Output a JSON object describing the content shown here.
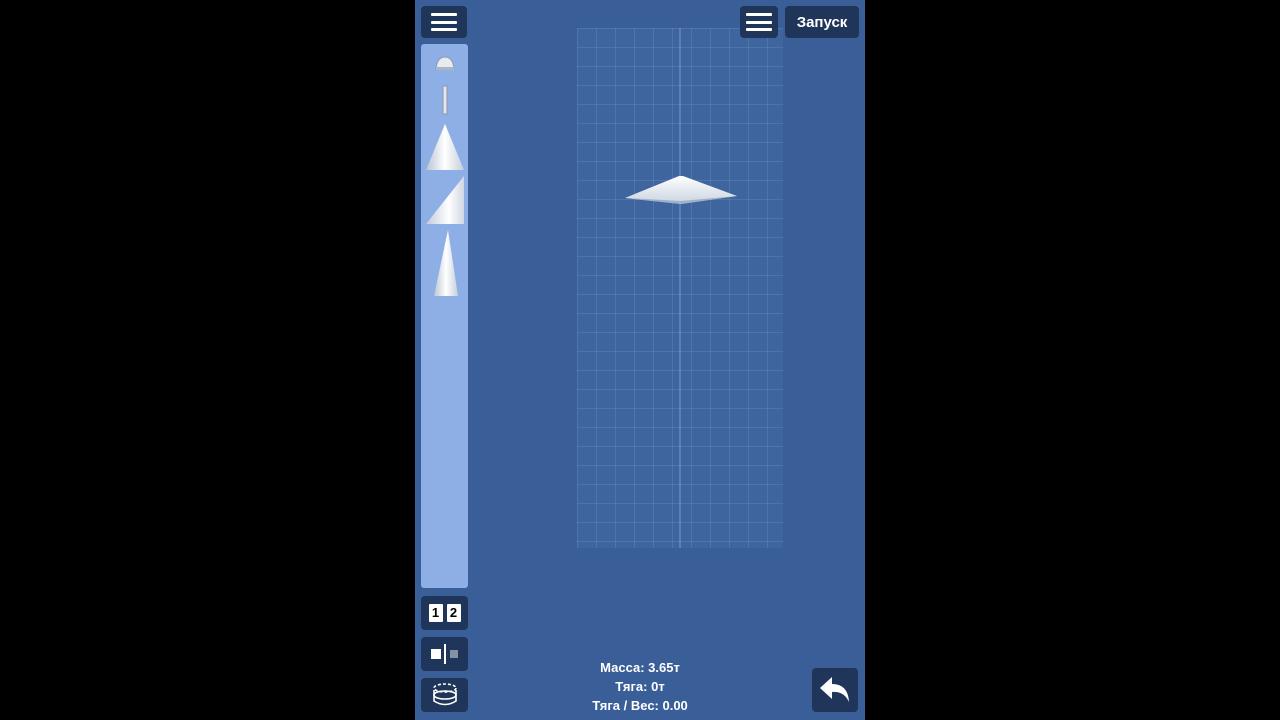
{
  "toolbar": {
    "left_menu_icon": "hamburger-menu-icon",
    "right_menu_icon": "hamburger-menu-icon",
    "launch_label": "Запуск"
  },
  "parts": [
    {
      "name": "capsule-part-icon"
    },
    {
      "name": "rod-part-icon"
    },
    {
      "name": "cone-part-icon"
    },
    {
      "name": "side-cone-part-icon"
    },
    {
      "name": "tall-cone-part-icon"
    }
  ],
  "tools": {
    "stage_one": "1",
    "stage_two": "2",
    "symmetry_icon": "symmetry-icon",
    "fuel_icon": "fuel-tank-icon"
  },
  "stats": {
    "mass": "Масса: 3.65т",
    "thrust": "Тяга: 0т",
    "twr": "Тяга / Вес: 0.00"
  },
  "undo_icon": "undo-arrow-icon",
  "colors": {
    "background": "#3a5f98",
    "panel": "#8eaee6",
    "button": "#1f3559"
  }
}
